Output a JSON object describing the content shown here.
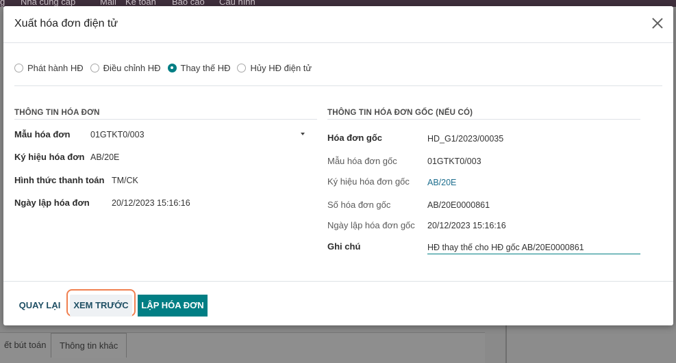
{
  "background": {
    "top_menu": [
      "g",
      "Nhà cung cấp",
      "Mail",
      "Kế toán",
      "Báo cáo",
      "Cấu hình"
    ],
    "tabs": [
      "ết bút toán",
      "Thông tin khác"
    ]
  },
  "modal": {
    "title": "Xuất hóa đơn điện tử",
    "close_icon": "close-icon",
    "radio_options": [
      {
        "label": "Phát hành HĐ",
        "checked": false
      },
      {
        "label": "Điều chỉnh HĐ",
        "checked": false
      },
      {
        "label": "Thay thế HĐ",
        "checked": true
      },
      {
        "label": "Hủy HĐ điện tử",
        "checked": false
      }
    ],
    "invoice_info": {
      "title": "THÔNG TIN HÓA ĐƠN",
      "template_label": "Mẫu hóa đơn",
      "template_value": "01GTKT0/003",
      "symbol_label": "Ký hiệu hóa đơn",
      "symbol_value": "AB/20E",
      "payment_label": "Hình thức thanh toán",
      "payment_value": "TM/CK",
      "date_label": "Ngày lập hóa đơn",
      "date_value": "20/12/2023 15:16:16"
    },
    "original_info": {
      "title": "THÔNG TIN HÓA ĐƠN GỐC (NẾU CÓ)",
      "original_label": "Hóa đơn gốc",
      "original_value": "HD_G1/2023/00035",
      "template_label": "Mẫu hóa đơn gốc",
      "template_value": "01GTKT0/003",
      "symbol_label": "Ký hiệu hóa đơn gốc",
      "symbol_value": "AB/20E",
      "number_label": "Số hóa đơn gốc",
      "number_value": "AB/20E0000861",
      "date_label": "Ngày lập hóa đơn gốc",
      "date_value": "20/12/2023 15:16:16",
      "note_label": "Ghi chú",
      "note_value": "HĐ thay thế cho HĐ gốc AB/20E0000861"
    },
    "footer": {
      "back_label": "QUAY LẠI",
      "preview_label": "XEM TRƯỚC",
      "submit_label": "LẬP HÓA ĐƠN"
    }
  },
  "colors": {
    "accent": "#017e84",
    "highlight": "#f07f4f",
    "link": "#1d6e8e"
  }
}
